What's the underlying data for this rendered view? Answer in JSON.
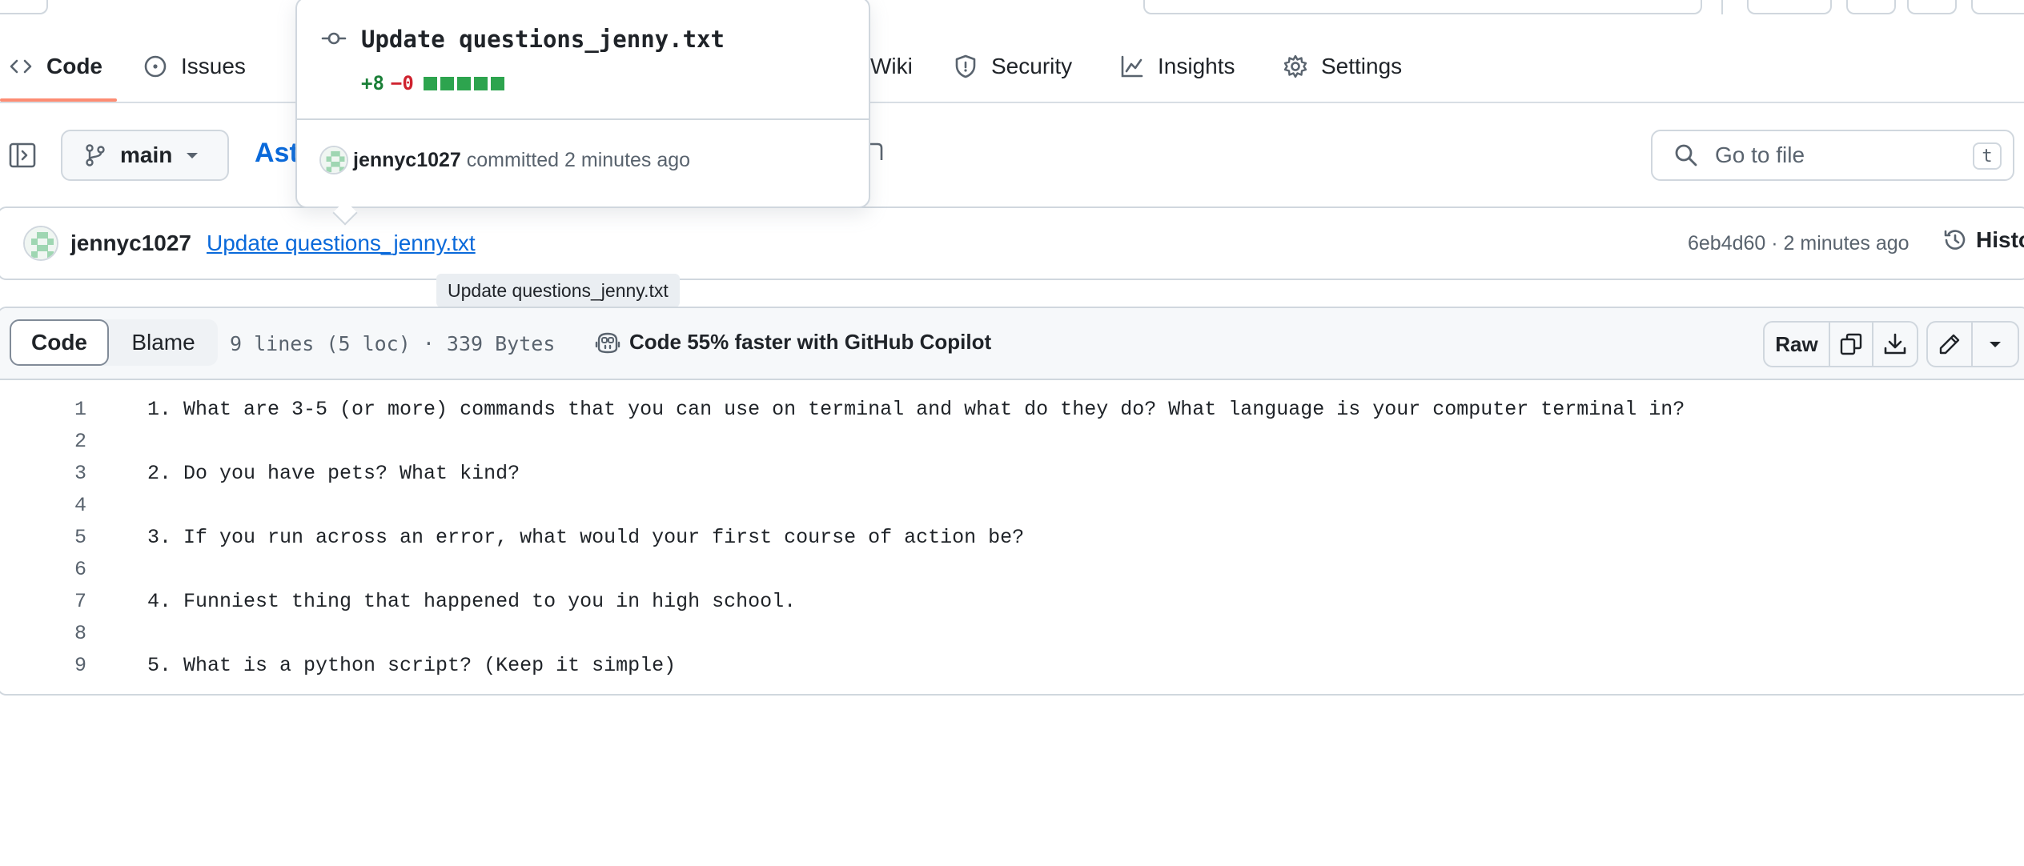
{
  "repo_nav": {
    "tabs": [
      {
        "label": "Code",
        "icon": "code-icon",
        "active": true
      },
      {
        "label": "Issues",
        "icon": "issue-icon"
      },
      {
        "label": "Wiki",
        "icon": "book-icon"
      },
      {
        "label": "Security",
        "icon": "shield-icon"
      },
      {
        "label": "Insights",
        "icon": "graph-icon"
      },
      {
        "label": "Settings",
        "icon": "gear-icon"
      }
    ]
  },
  "toolbar": {
    "branch": "main",
    "breadcrumb_fragment": "Ast",
    "go_to_file_placeholder": "Go to file",
    "go_to_file_shortcut": "t"
  },
  "popover": {
    "title": "Update questions_jenny.txt",
    "additions": "+8",
    "deletions": "−0",
    "diff_blocks_green": 5,
    "author": "jennyc1027",
    "action_text": "committed 2 minutes ago"
  },
  "commit": {
    "author": "jennyc1027",
    "message": "Update questions_jenny.txt",
    "meta": "6eb4d60 · 2 minutes ago",
    "history_label": "Histo"
  },
  "tooltip": {
    "text": "Update questions_jenny.txt"
  },
  "file": {
    "view_tabs": [
      "Code",
      "Blame"
    ],
    "info": "9 lines (5 loc) · 339 Bytes",
    "copilot_text": "Code 55% faster with GitHub Copilot",
    "raw_label": "Raw",
    "lines": [
      {
        "n": "1",
        "text": "1. What are 3-5 (or more) commands that you can use on terminal and what do they do? What language is your computer terminal in?"
      },
      {
        "n": "2",
        "text": ""
      },
      {
        "n": "3",
        "text": "2. Do you have pets? What kind?"
      },
      {
        "n": "4",
        "text": ""
      },
      {
        "n": "5",
        "text": "3. If you run across an error, what would your first course of action be?"
      },
      {
        "n": "6",
        "text": ""
      },
      {
        "n": "7",
        "text": "4. Funniest thing that happened to you in high school."
      },
      {
        "n": "8",
        "text": ""
      },
      {
        "n": "9",
        "text": "5. What is a python script? (Keep it simple)"
      }
    ]
  },
  "colors": {
    "link": "#0969da",
    "tab_underline": "#fd8c73",
    "additions": "#1a7f37",
    "deletions": "#cf222e"
  }
}
